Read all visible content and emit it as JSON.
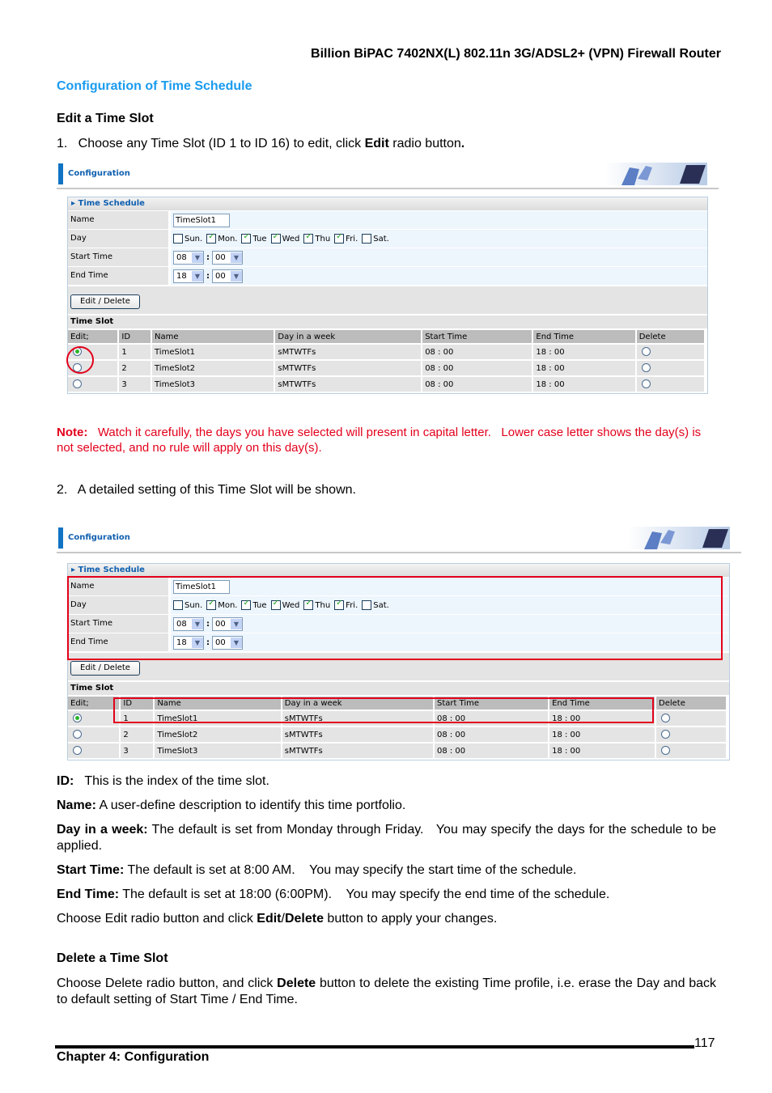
{
  "header": "Billion BiPAC 7402NX(L) 802.11n 3G/ADSL2+ (VPN) Firewall Router",
  "section_title": "Configuration of Time Schedule",
  "edit_title": "Edit a Time Slot",
  "step1": {
    "prefix": "1.   Choose any Time Slot (ID 1 to ID 16) to edit, click ",
    "bold": "Edit",
    "suffix": " radio button",
    "end": "."
  },
  "ui": {
    "config_title": "Configuration",
    "panel_title": "Time Schedule",
    "labels": {
      "name": "Name",
      "day": "Day",
      "start": "Start Time",
      "end": "End Time"
    },
    "name_value": "TimeSlot1",
    "days": [
      {
        "label": "Sun.",
        "checked": false
      },
      {
        "label": "Mon.",
        "checked": true
      },
      {
        "label": "Tue",
        "checked": true
      },
      {
        "label": "Wed",
        "checked": true
      },
      {
        "label": "Thu",
        "checked": true
      },
      {
        "label": "Fri.",
        "checked": true
      },
      {
        "label": "Sat.",
        "checked": false
      }
    ],
    "start_hour": "08",
    "start_min": "00",
    "end_hour": "18",
    "end_min": "00",
    "colon": ":",
    "button": "Edit / Delete",
    "time_slot_title": "Time Slot",
    "columns": [
      "Edit;",
      "ID",
      "Name",
      "Day in a week",
      "Start Time",
      "End Time",
      "Delete"
    ],
    "rows": [
      {
        "id": "1",
        "name": "TimeSlot1",
        "days": "sMTWTFs",
        "start": "08 : 00",
        "end": "18 : 00",
        "edit_selected": true
      },
      {
        "id": "2",
        "name": "TimeSlot2",
        "days": "sMTWTFs",
        "start": "08 : 00",
        "end": "18 : 00",
        "edit_selected": false
      },
      {
        "id": "3",
        "name": "TimeSlot3",
        "days": "sMTWTFs",
        "start": "08 : 00",
        "end": "18 : 00",
        "edit_selected": false
      }
    ]
  },
  "note": {
    "label": "Note:",
    "text": "   Watch it carefully, the days you have selected will present in capital letter.   Lower case letter shows the day(s) is not selected, and no rule will apply on this day(s)."
  },
  "step2": "2.   A detailed setting of this Time Slot will be shown.",
  "defs": [
    {
      "term": "ID:",
      "text": "   This is the index of the time slot."
    },
    {
      "term": "Name:",
      "text": " A user-define description to identify this time portfolio."
    },
    {
      "term": "Day in a week:",
      "text": " The default is set from Monday through Friday.   You may specify the days for the schedule to be applied."
    },
    {
      "term": "Start Time:",
      "text": " The default is set at 8:00 AM.    You may specify the start time of the schedule."
    },
    {
      "term": "End Time:",
      "text": " The default is set at 18:00 (6:00PM).    You may specify the end time of the schedule."
    }
  ],
  "apply": {
    "prefix": "Choose Edit radio button and click ",
    "b1": "Edit",
    "slash": "/",
    "b2": "Delete",
    "suffix": " button to apply your changes."
  },
  "delete_title": "Delete a Time Slot",
  "delete_text": {
    "prefix": "Choose Delete radio button, and click ",
    "bold": "Delete",
    "suffix": " button to delete the existing Time profile, i.e. erase the Day and back to default setting of Start Time / End Time."
  },
  "footer": {
    "chapter": "Chapter 4: Configuration",
    "page": "117"
  }
}
